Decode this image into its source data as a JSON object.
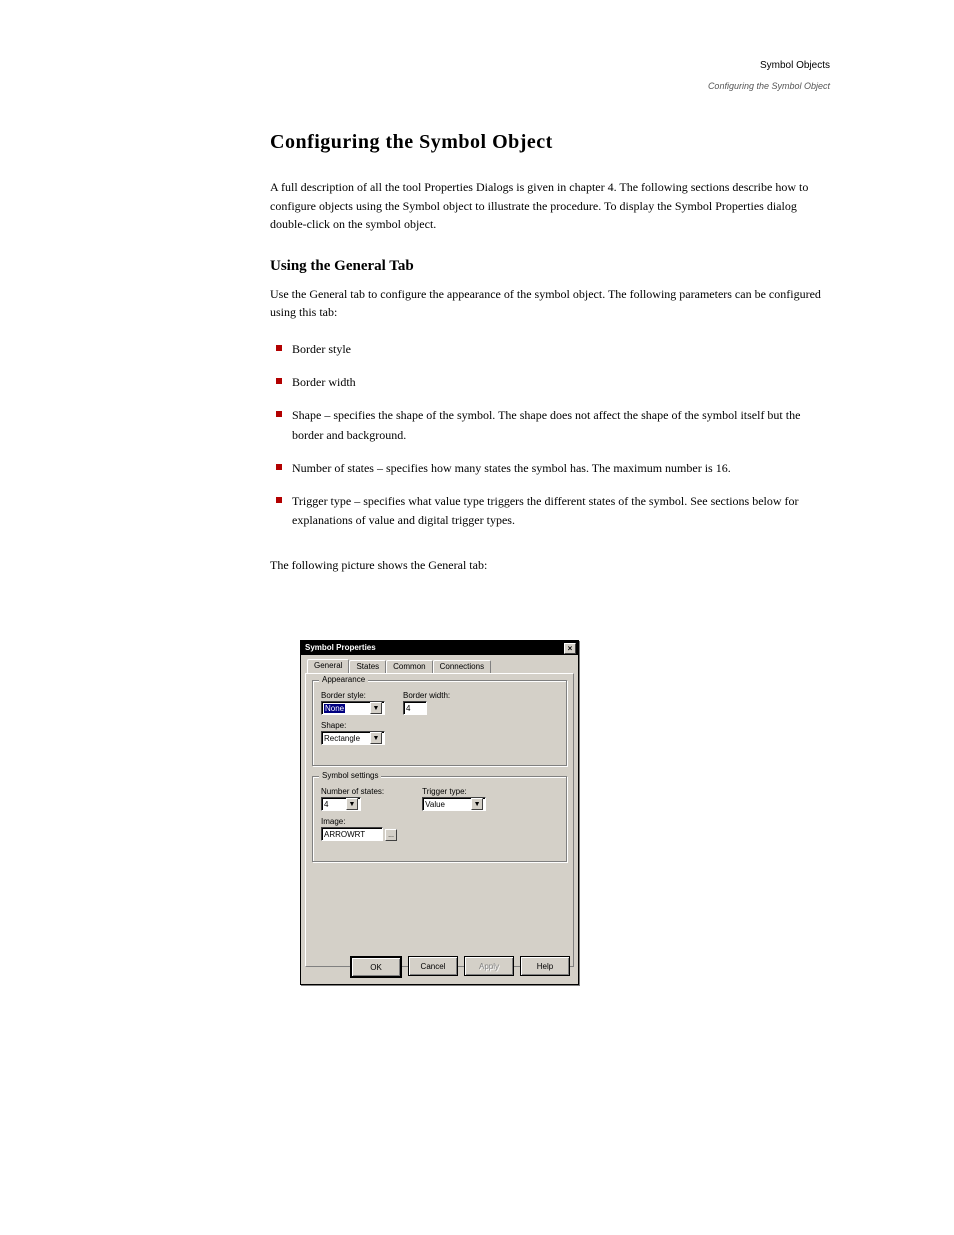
{
  "runhead": {
    "title": "Symbol Objects",
    "subtitle": "Configuring the Symbol Object"
  },
  "doc": {
    "h1": "Configuring the Symbol Object",
    "intro": "A full description of all the tool Properties Dialogs is given in chapter 4. The following sections describe how to configure objects using the Symbol object to illustrate the procedure. To display the Symbol Properties dialog double-click on the symbol object.",
    "h2": "Using the General Tab",
    "p_general": "Use the General tab to configure the appearance of the symbol object. The following parameters can be configured using this tab:",
    "bullets": [
      "Border style",
      "Border width",
      "Shape – specifies the shape of the symbol. The shape does not affect the shape of the symbol itself but the border and background.",
      "Number of states – specifies how many states the symbol has. The maximum number is 16.",
      "Trigger type – specifies what value type triggers the different states of the symbol. See sections below for explanations of value and digital trigger types."
    ],
    "p_after": "The following picture shows the General tab:"
  },
  "dialog": {
    "title": "Symbol Properties",
    "close_glyph": "×",
    "tabs": [
      "General",
      "States",
      "Common",
      "Connections"
    ],
    "appearance": {
      "legend": "Appearance",
      "border_style_label": "Border style:",
      "border_style_value": "None",
      "border_width_label": "Border width:",
      "border_width_value": "4",
      "shape_label": "Shape:",
      "shape_value": "Rectangle"
    },
    "symbol_settings": {
      "legend": "Symbol settings",
      "num_states_label": "Number of states:",
      "num_states_value": "4",
      "trigger_label": "Trigger type:",
      "trigger_value": "Value",
      "image_label": "Image:",
      "image_value": "ARROWRT",
      "browse_glyph": "..."
    },
    "buttons": {
      "ok": "OK",
      "cancel": "Cancel",
      "apply": "Apply",
      "help": "Help"
    },
    "chevron": "▼"
  }
}
